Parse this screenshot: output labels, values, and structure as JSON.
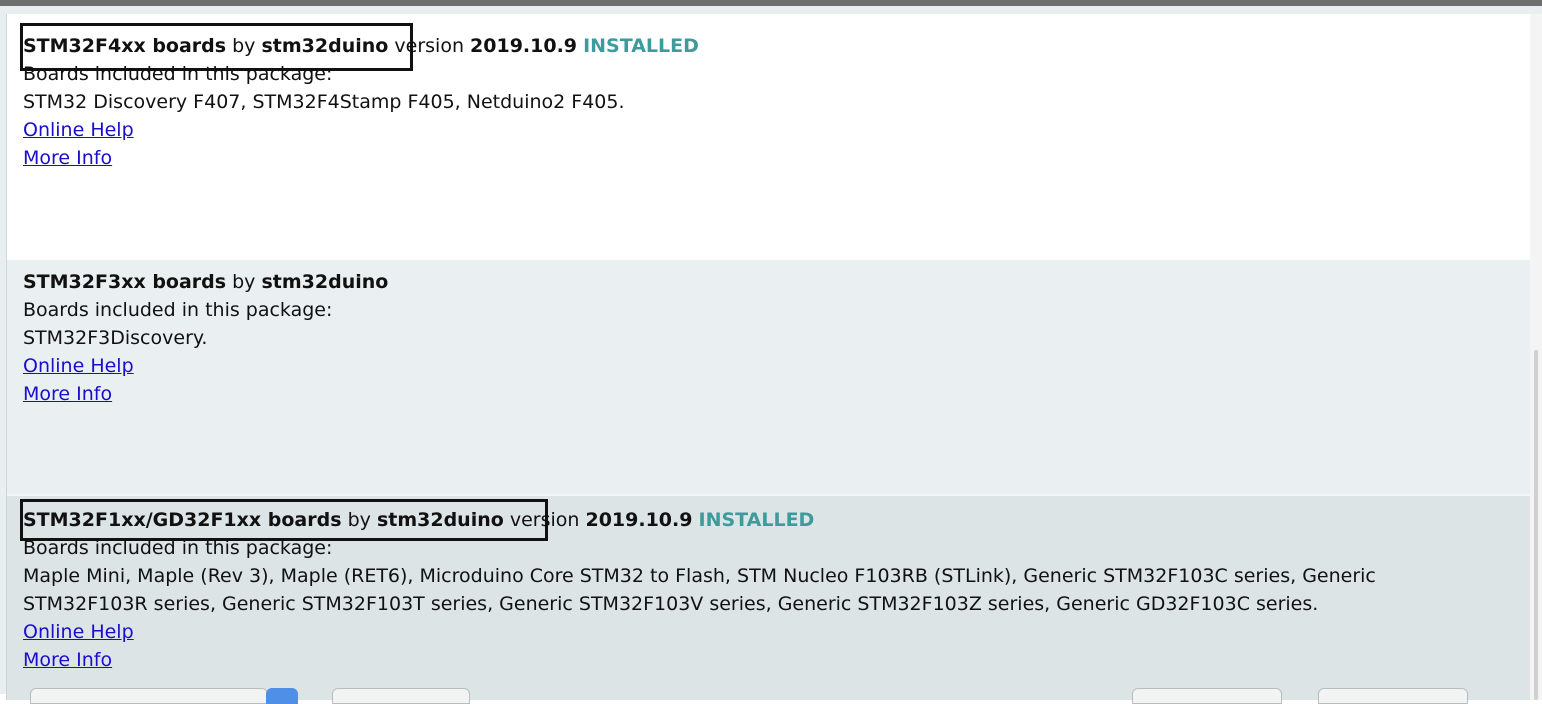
{
  "packages": [
    {
      "name": "STM32F4xx boards",
      "by": "by",
      "author": "stm32duino",
      "version_label": "version",
      "version": "2019.10.9",
      "status": "INSTALLED",
      "boards_heading": "Boards included in this package:",
      "boards": "STM32 Discovery F407, STM32F4Stamp F405, Netduino2 F405.",
      "online_help": "Online Help",
      "more_info": "More Info"
    },
    {
      "name": "STM32F3xx boards",
      "by": "by",
      "author": "stm32duino",
      "boards_heading": "Boards included in this package:",
      "boards": "STM32F3Discovery.",
      "online_help": "Online Help",
      "more_info": "More Info"
    },
    {
      "name": "STM32F1xx/GD32F1xx boards",
      "by": "by",
      "author": "stm32duino",
      "version_label": "version",
      "version": "2019.10.9",
      "status": "INSTALLED",
      "boards_heading": "Boards included in this package:",
      "boards": "Maple Mini, Maple (Rev 3), Maple (RET6), Microduino Core STM32 to Flash, STM Nucleo F103RB (STLink), Generic STM32F103C series, Generic STM32F103R series, Generic STM32F103T series, Generic STM32F103V series, Generic STM32F103Z series, Generic GD32F103C series.",
      "online_help": "Online Help",
      "more_info": "More Info"
    }
  ],
  "colors": {
    "installed": "#3d9a9d",
    "link": "#1a0dcc",
    "highlight_box": "#111111",
    "row_alt_1": "#eaf0f1",
    "row_alt_2": "#dde4e6"
  }
}
